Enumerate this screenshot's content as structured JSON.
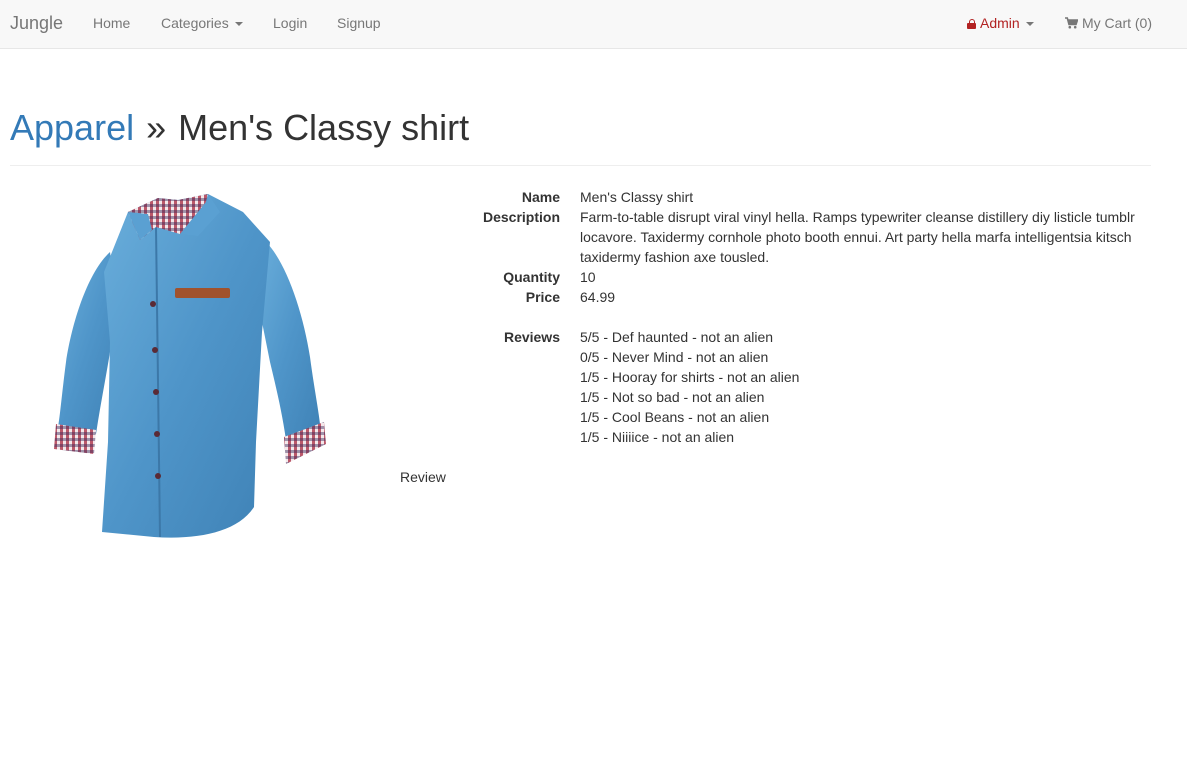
{
  "navbar": {
    "brand": "Jungle",
    "links": {
      "home": "Home",
      "categories": "Categories",
      "login": "Login",
      "signup": "Signup"
    },
    "admin_label": "Admin",
    "cart_label": "My Cart (0)"
  },
  "breadcrumb": {
    "category": "Apparel",
    "separator": "»",
    "product": "Men's Classy shirt"
  },
  "product": {
    "labels": {
      "name": "Name",
      "description": "Description",
      "quantity": "Quantity",
      "price": "Price",
      "reviews": "Reviews"
    },
    "name": "Men's Classy shirt",
    "description": "Farm-to-table disrupt viral vinyl hella. Ramps typewriter cleanse distillery diy listicle tumblr locavore. Taxidermy cornhole photo booth ennui. Art party hella marfa intelligentsia kitsch taxidermy fashion axe tousled.",
    "quantity": "10",
    "price": "64.99",
    "reviews": [
      "5/5 - Def haunted - not an alien",
      "0/5 - Never Mind - not an alien",
      "1/5 - Hooray for shirts - not an alien",
      "1/5 - Not so bad - not an alien",
      "1/5 - Cool Beans - not an alien",
      "1/5 - Niiiice - not an alien"
    ],
    "review_link": "Review"
  },
  "colors": {
    "link_blue": "#337ab7",
    "admin_red": "#b22222",
    "navbar_bg": "#f8f8f8",
    "shirt_blue": "#5b9fd0"
  },
  "icons": {
    "admin": "lock-icon",
    "cart": "cart-icon"
  }
}
